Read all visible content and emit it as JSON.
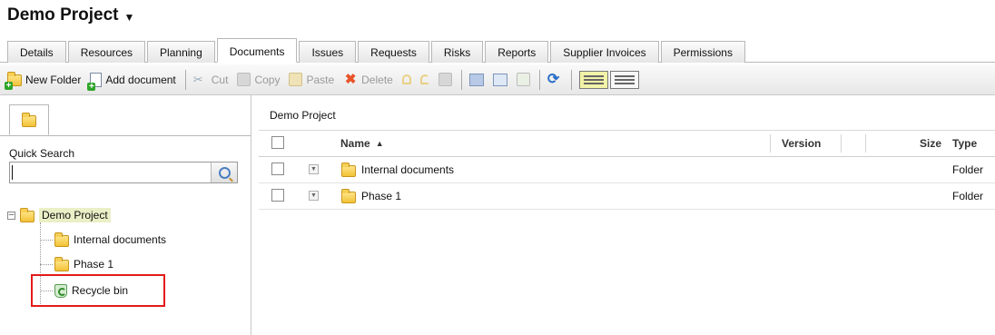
{
  "header": {
    "title": "Demo Project"
  },
  "tabs": [
    {
      "label": "Details",
      "active": false
    },
    {
      "label": "Resources",
      "active": false
    },
    {
      "label": "Planning",
      "active": false
    },
    {
      "label": "Documents",
      "active": true
    },
    {
      "label": "Issues",
      "active": false
    },
    {
      "label": "Requests",
      "active": false
    },
    {
      "label": "Risks",
      "active": false
    },
    {
      "label": "Reports",
      "active": false
    },
    {
      "label": "Supplier Invoices",
      "active": false
    },
    {
      "label": "Permissions",
      "active": false
    }
  ],
  "toolbar": {
    "new_folder": "New Folder",
    "add_document": "Add document",
    "cut": "Cut",
    "copy": "Copy",
    "paste": "Paste",
    "delete": "Delete"
  },
  "left_panel": {
    "quick_search_label": "Quick Search",
    "search_value": "",
    "tree": {
      "root": "Demo Project",
      "children": [
        "Internal documents",
        "Phase 1",
        "Recycle bin"
      ]
    }
  },
  "main": {
    "breadcrumb": "Demo Project",
    "columns": {
      "name": "Name",
      "sort_indicator": "▲",
      "version": "Version",
      "size": "Size",
      "type": "Type"
    },
    "rows": [
      {
        "name": "Internal documents",
        "version": "",
        "size": "",
        "type": "Folder"
      },
      {
        "name": "Phase 1",
        "version": "",
        "size": "",
        "type": "Folder"
      }
    ]
  },
  "colors": {
    "highlight_box": "#e21b1b",
    "selected_node_bg": "#eaefc6"
  }
}
